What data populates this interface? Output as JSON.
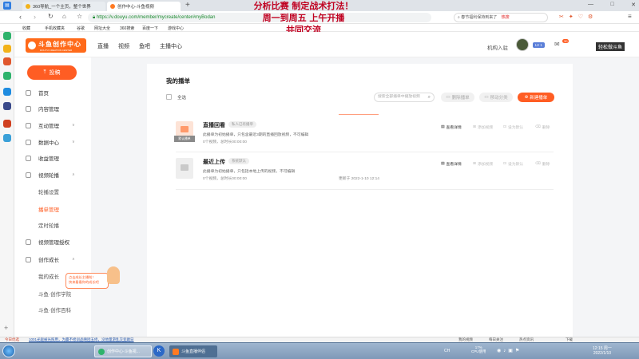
{
  "browser": {
    "tabs": [
      {
        "title": "360导航_一个主页，整个世界"
      },
      {
        "title": "创作中心-斗鱼视频"
      }
    ],
    "new_tab": "+",
    "url": "https://v.douyu.com/member/mycreate/center#myBodan",
    "search_placeholder": "春节福利保持到来了",
    "search_hot": "热搜",
    "bookmarks": [
      "收藏",
      "手机收藏夹",
      "谷歌",
      "网址大全",
      "360搜索",
      "百度一下",
      "游戏中心"
    ],
    "window_controls": [
      "—",
      "□",
      "✕"
    ]
  },
  "overlay_caption": [
    "分析比赛 制定战术打法！",
    "周一到周五 上午开播",
    "共同交流"
  ],
  "site": {
    "logo_text": "斗鱼创作中心",
    "logo_sub": "DOUYU CREATION CENTER",
    "nav": [
      "直播",
      "视频",
      "鱼吧",
      "主播中心"
    ],
    "right_link": "机构入驻",
    "level_badge": "LV 1",
    "msg_count": "30",
    "slogan": "轻松做斗鱼"
  },
  "sidebar": {
    "upload_label": "投稿",
    "items": [
      {
        "label": "首页",
        "type": "item"
      },
      {
        "label": "内容管理",
        "type": "item"
      },
      {
        "label": "互动管理",
        "type": "group",
        "chevron": "∨"
      },
      {
        "label": "数据中心",
        "type": "group",
        "chevron": "∨"
      },
      {
        "label": "收益管理",
        "type": "item"
      },
      {
        "label": "视频轮播",
        "type": "group",
        "chevron": "∧"
      },
      {
        "label": "轮播设置",
        "type": "sub"
      },
      {
        "label": "播单管理",
        "type": "sub",
        "active": true
      },
      {
        "label": "定时轮播",
        "type": "sub"
      },
      {
        "label": "视频管理授权",
        "type": "item"
      },
      {
        "label": "创作成长",
        "type": "group",
        "chevron": "∧"
      },
      {
        "label": "我的成长",
        "type": "sub"
      },
      {
        "label": "斗鱼·创作学院",
        "type": "sub"
      },
      {
        "label": "斗鱼·创作百科",
        "type": "sub"
      }
    ],
    "tip": [
      "点击成长主播啦！",
      "快来看看你的成长吧"
    ]
  },
  "main": {
    "title": "我的播单",
    "select_all": "全选",
    "search_placeholder": "搜索全部播单中播放视频",
    "btn_delete": "删除播单",
    "btn_move": "移动分类",
    "btn_new": "新建播单",
    "rows": [
      {
        "title": "直播回看",
        "badge": "私人已有播单",
        "desc": "此播单为初始播单，只包含最近3期的直播回放视频，不可编辑",
        "meta": "0个视频，总时长00:00:00",
        "updated": "",
        "thumb_label": "默认播单",
        "actions": [
          "查看详情",
          "添加视频",
          "设为默认",
          "删除"
        ]
      },
      {
        "title": "最近上传",
        "badge": "系统默认",
        "desc": "此播单为初始播单，只包括本地上传的视频，不可编辑",
        "meta": "0个视频，总时长00:00:00",
        "updated": "更新于 2022-1-10 12:14",
        "thumb_label": "",
        "actions": [
          "查看详情",
          "添加视频",
          "设为默认",
          "删除"
        ]
      }
    ]
  },
  "statusbar": {
    "left": [
      "今日优选",
      "1001光驱被光照用，为赢不修训品嘻团五修，没他量游乱交变踢日"
    ],
    "right": [
      "我的视频",
      "每日关注",
      "热点资讯",
      "下载"
    ]
  },
  "taskbar": {
    "tasks": [
      "创作中心-斗鱼视...",
      "斗鱼直播伴侣"
    ],
    "cpu": "17%",
    "cpu_label": "CPU使用",
    "time": "12:15 周一",
    "date": "2022/1/10",
    "tray": "CH"
  },
  "colors": {
    "accent": "#ff5d23",
    "overlay": "#c00020"
  }
}
